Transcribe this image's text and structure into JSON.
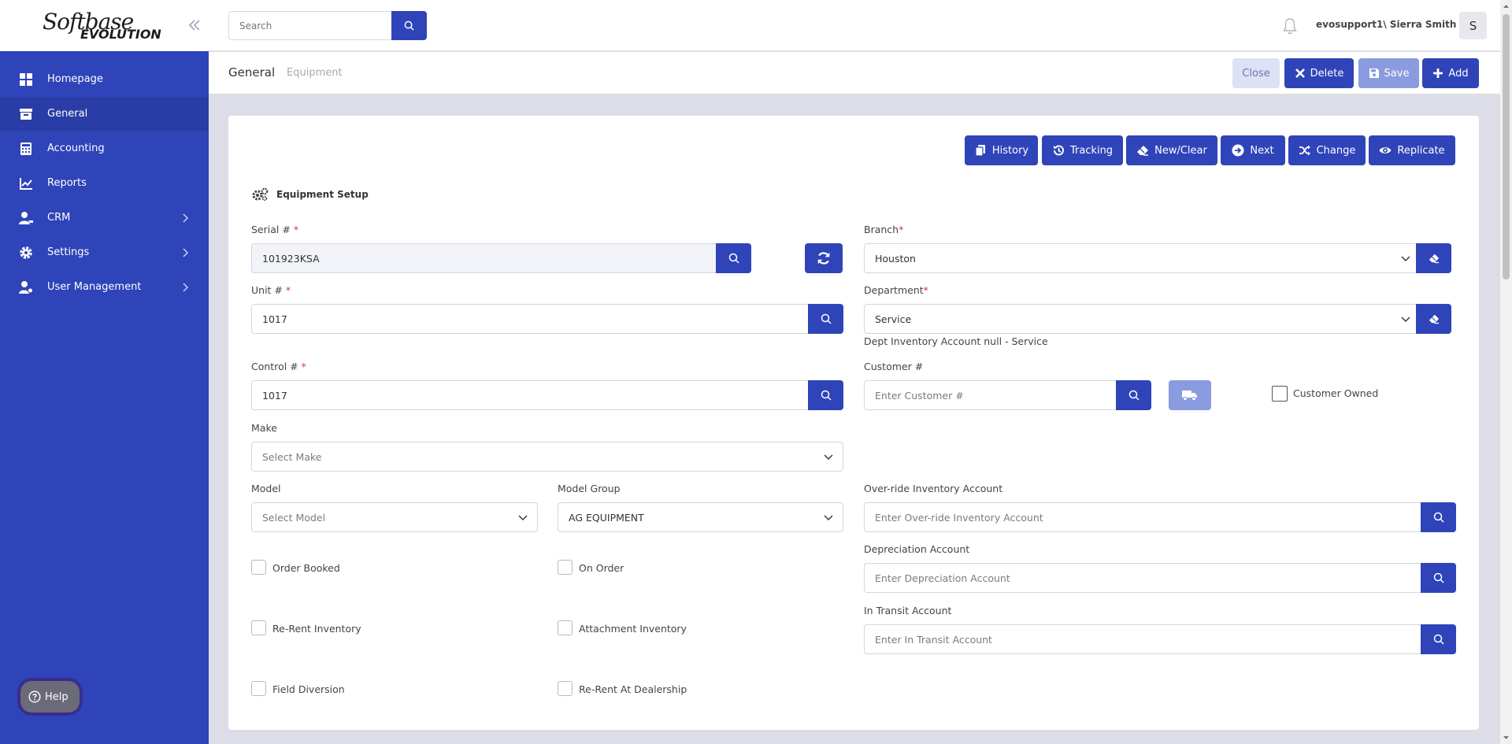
{
  "logo": {
    "line1": "Softbase",
    "line2": "EVOLUTION"
  },
  "sidebar": {
    "items": [
      {
        "label": "Homepage"
      },
      {
        "label": "General"
      },
      {
        "label": "Accounting"
      },
      {
        "label": "Reports"
      },
      {
        "label": "CRM"
      },
      {
        "label": "Settings"
      },
      {
        "label": "User Management"
      }
    ],
    "help_label": "Help"
  },
  "topbar": {
    "search_placeholder": "Search",
    "username": "evosupport1\\ Sierra Smith",
    "avatar_letter": "S"
  },
  "breadcrumb": {
    "section": "General",
    "page": "Equipment"
  },
  "header_actions": {
    "close": "Close",
    "delete": "Delete",
    "save": "Save",
    "add": "Add"
  },
  "toolbar": {
    "history": "History",
    "tracking": "Tracking",
    "new_clear": "New/Clear",
    "next": "Next",
    "change": "Change",
    "replicate": "Replicate"
  },
  "form": {
    "section_title": "Equipment Setup",
    "serial": {
      "label": "Serial #",
      "required": "*",
      "value": "101923KSA"
    },
    "unit": {
      "label": "Unit #",
      "required": "*",
      "value": "1017"
    },
    "control": {
      "label": "Control #",
      "required": "*",
      "value": "1017"
    },
    "make": {
      "label": "Make",
      "placeholder": "Select Make"
    },
    "model": {
      "label": "Model",
      "placeholder": "Select Model"
    },
    "model_group": {
      "label": "Model Group",
      "value": "AG EQUIPMENT"
    },
    "branch": {
      "label": "Branch",
      "required": "*",
      "value": "Houston"
    },
    "department": {
      "label": "Department",
      "required": "*",
      "value": "Service"
    },
    "dept_note": "Dept Inventory Account null - Service",
    "customer": {
      "label": "Customer #",
      "placeholder": "Enter Customer #"
    },
    "customer_owned": "Customer Owned",
    "override_account": {
      "label": "Over-ride Inventory Account",
      "placeholder": "Enter Over-ride Inventory Account"
    },
    "depreciation_account": {
      "label": "Depreciation Account",
      "placeholder": "Enter Depreciation Account"
    },
    "in_transit_account": {
      "label": "In Transit Account",
      "placeholder": "Enter In Transit Account"
    },
    "checkboxes": {
      "order_booked": "Order Booked",
      "on_order": "On Order",
      "re_rent_inventory": "Re-Rent Inventory",
      "attachment_inventory": "Attachment Inventory",
      "field_diversion": "Field Diversion",
      "re_rent_at_dealership": "Re-Rent At Dealership"
    }
  },
  "colors": {
    "primary": "#2f44b9",
    "sidebar_active": "#2a3da7",
    "disabled_button": "#8b9be0",
    "close_button": "#dde1f5",
    "page_bg": "#dcdde6"
  }
}
